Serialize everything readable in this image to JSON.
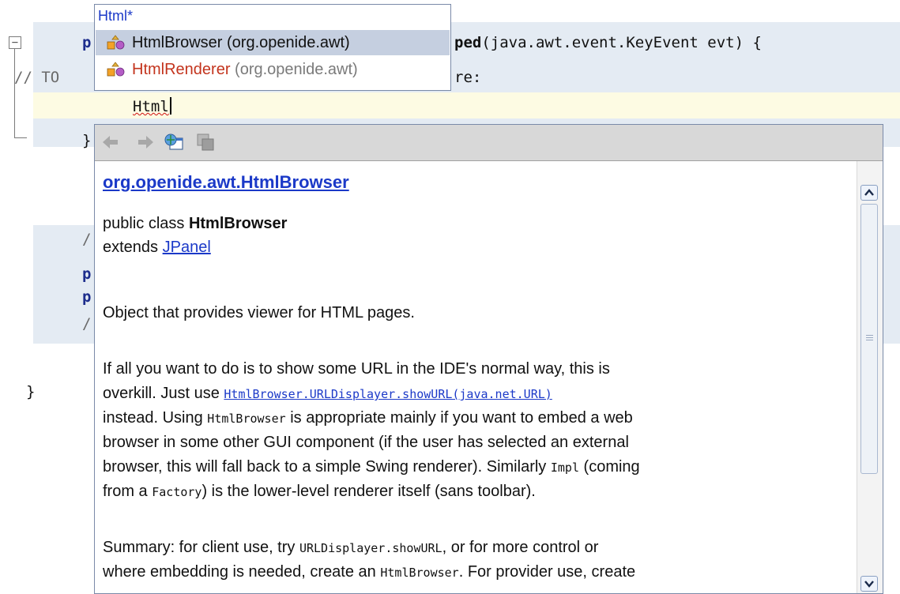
{
  "editor": {
    "fold_symbol": "−",
    "line_method_kw": "p",
    "line_method_rest": "ped",
    "line_method_args": "(java.awt.event.KeyEvent evt) {",
    "line_comment_start": "// TO",
    "line_comment_end": "re:",
    "typed_text": "Html",
    "close_brace_inner": "}",
    "javadoc_slash_1": "/",
    "kw_p": "p",
    "javadoc_slash_2": "/",
    "close_brace_class": "}"
  },
  "completion": {
    "filter_text": "Html*",
    "items": [
      {
        "name": "HtmlBrowser",
        "package": "(org.openide.awt)",
        "selected": true
      },
      {
        "name": "HtmlRenderer",
        "package": "(org.openide.awt)",
        "selected": false
      }
    ],
    "icon": "class-icon"
  },
  "javadoc": {
    "toolbar": {
      "back": "back-arrow-icon",
      "forward": "forward-arrow-icon",
      "open_browser": "open-in-browser-icon",
      "goto_source": "goto-source-icon"
    },
    "title": "org.openide.awt.HtmlBrowser",
    "decl_prefix": "public class ",
    "decl_class": "HtmlBrowser",
    "extends_prefix": "extends ",
    "extends_link": "JPanel",
    "summary": "Object that provides viewer for HTML pages.",
    "p1_l1": "If all you want to do is to show some URL in the IDE's normal way, this is",
    "p1_l2_a": "overkill. Just use ",
    "p1_l2_link": "HtmlBrowser.URLDisplayer.showURL(java.net.URL)",
    "p1_l3_a": "instead. Using ",
    "p1_l3_code": "HtmlBrowser",
    "p1_l3_b": " is appropriate mainly if you want to embed a web",
    "p1_l4": "browser in some other GUI component (if the user has selected an external",
    "p1_l5_a": "browser, this will fall back to a simple Swing renderer). Similarly ",
    "p1_l5_code": "Impl",
    "p1_l5_b": " (coming",
    "p1_l6_a": "from a ",
    "p1_l6_code": "Factory",
    "p1_l6_b": ") is the lower-level renderer itself (sans toolbar).",
    "p2_l1_a": "Summary: for client use, try ",
    "p2_l1_code": "URLDisplayer.showURL",
    "p2_l1_b": ", or for more control or",
    "p2_l2_a": "where embedding is needed, create an ",
    "p2_l2_code": "HtmlBrowser",
    "p2_l2_b": ". For provider use, create"
  }
}
